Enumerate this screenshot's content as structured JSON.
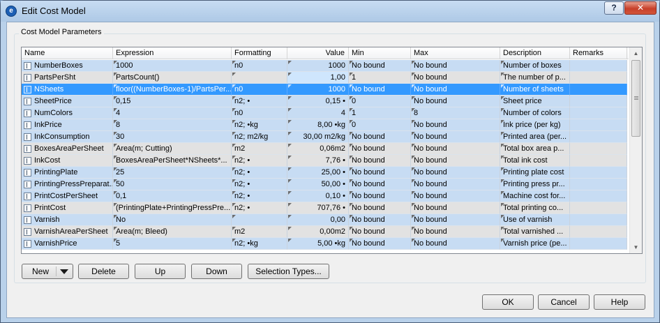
{
  "window": {
    "title": "Edit Cost Model",
    "help_label": "?",
    "close_label": "✕"
  },
  "group": {
    "title": "Cost Model Parameters"
  },
  "columns": [
    {
      "label": "Name"
    },
    {
      "label": "Expression"
    },
    {
      "label": "Formatting"
    },
    {
      "label": "Value"
    },
    {
      "label": "Min"
    },
    {
      "label": "Max"
    },
    {
      "label": "Description"
    },
    {
      "label": "Remarks"
    }
  ],
  "rows": [
    {
      "name": "NumberBoxes",
      "expression": "1000",
      "formatting": "n0",
      "value": "1000",
      "min": "No bound",
      "max": "No bound",
      "description": "Number of boxes",
      "remarks": ""
    },
    {
      "name": "PartsPerSht",
      "expression": "PartsCount()",
      "formatting": "",
      "value": "1,00",
      "min": "1",
      "max": "No bound",
      "description": "The number of p...",
      "remarks": ""
    },
    {
      "name": "NSheets",
      "expression": "floor((NumberBoxes-1)/PartsPer...",
      "formatting": "n0",
      "value": "1000",
      "min": "No bound",
      "max": "No bound",
      "description": "Number of sheets",
      "remarks": ""
    },
    {
      "name": "SheetPrice",
      "expression": "0,15",
      "formatting": "n2; •",
      "value": "0,15 •",
      "min": "0",
      "max": "No bound",
      "description": "Sheet price",
      "remarks": ""
    },
    {
      "name": "NumColors",
      "expression": "4",
      "formatting": "n0",
      "value": "4",
      "min": "1",
      "max": "8",
      "description": "Number of colors",
      "remarks": ""
    },
    {
      "name": "InkPrice",
      "expression": "8",
      "formatting": "n2; •kg",
      "value": "8,00 •kg",
      "min": "0",
      "max": "No bound",
      "description": "Ink price (per kg)",
      "remarks": ""
    },
    {
      "name": "InkConsumption",
      "expression": "30",
      "formatting": "n2; m2/kg",
      "value": "30,00 m2/kg",
      "min": "No bound",
      "max": "No bound",
      "description": "Printed area (per...",
      "remarks": ""
    },
    {
      "name": "BoxesAreaPerSheet",
      "expression": "Area(m; Cutting)",
      "formatting": "m2",
      "value": "0,06m2",
      "min": "No bound",
      "max": "No bound",
      "description": "Total box area p...",
      "remarks": ""
    },
    {
      "name": "InkCost",
      "expression": "BoxesAreaPerSheet*NSheets*...",
      "formatting": "n2; •",
      "value": "7,76 •",
      "min": "No bound",
      "max": "No bound",
      "description": "Total ink cost",
      "remarks": ""
    },
    {
      "name": "PrintingPlate",
      "expression": "25",
      "formatting": "n2; •",
      "value": "25,00 •",
      "min": "No bound",
      "max": "No bound",
      "description": "Printing plate cost",
      "remarks": ""
    },
    {
      "name": "PrintingPressPreparat...",
      "expression": "50",
      "formatting": "n2; •",
      "value": "50,00 •",
      "min": "No bound",
      "max": "No bound",
      "description": "Printing press pr...",
      "remarks": ""
    },
    {
      "name": "PrintCostPerSheet",
      "expression": "0,1",
      "formatting": "n2; •",
      "value": "0,10 •",
      "min": "No bound",
      "max": "No bound",
      "description": "Machine cost for...",
      "remarks": ""
    },
    {
      "name": "PrintCost",
      "expression": "(PrintingPlate+PrintingPressPre...",
      "formatting": "n2; •",
      "value": "707,76 •",
      "min": "No bound",
      "max": "No bound",
      "description": "Total printing co...",
      "remarks": ""
    },
    {
      "name": "Varnish",
      "expression": "No",
      "formatting": "",
      "value": "0,00",
      "min": "No bound",
      "max": "No bound",
      "description": "Use of varnish",
      "remarks": ""
    },
    {
      "name": "VarnishAreaPerSheet",
      "expression": "Area(m; Bleed)",
      "formatting": "m2",
      "value": "0,00m2",
      "min": "No bound",
      "max": "No bound",
      "description": "Total varnished ...",
      "remarks": ""
    },
    {
      "name": "VarnishPrice",
      "expression": "5",
      "formatting": "n2; •kg",
      "value": "5,00 •kg",
      "min": "No bound",
      "max": "No bound",
      "description": "Varnish price (pe...",
      "remarks": ""
    }
  ],
  "buttons": {
    "new": "New",
    "delete": "Delete",
    "up": "Up",
    "down": "Down",
    "selection_types": "Selection Types...",
    "ok": "OK",
    "cancel": "Cancel",
    "help": "Help"
  }
}
